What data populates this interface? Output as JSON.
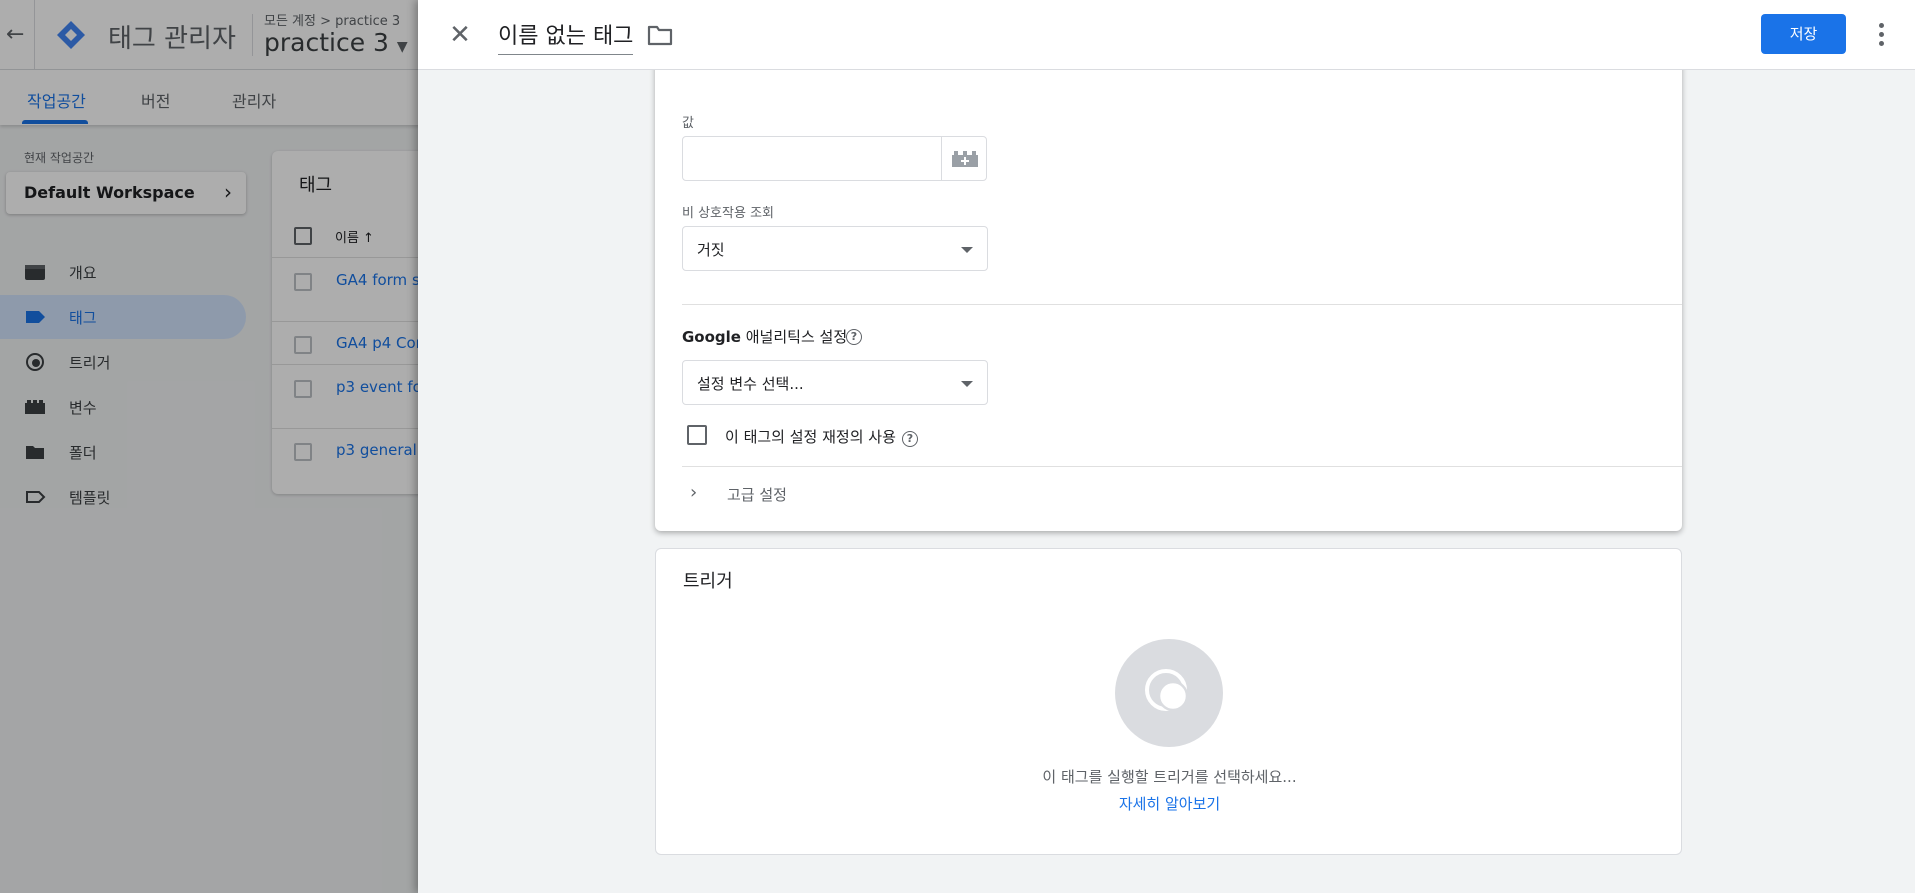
{
  "background_app": {
    "back_icon": "arrow-back-icon",
    "app_title": "태그 관리자",
    "breadcrumb_account": "모든 계정",
    "breadcrumb_sep": ">",
    "breadcrumb_container": "practice 3",
    "container_name": "practice 3",
    "tabs": [
      {
        "label": "작업공간",
        "active": true
      },
      {
        "label": "버전",
        "active": false
      },
      {
        "label": "관리자",
        "active": false
      }
    ],
    "workspace_label": "현재 작업공간",
    "workspace_name": "Default Workspace",
    "nav": [
      {
        "label": "개요",
        "icon": "overview-icon",
        "active": false
      },
      {
        "label": "태그",
        "icon": "tag-icon",
        "active": true
      },
      {
        "label": "트리거",
        "icon": "trigger-icon",
        "active": false
      },
      {
        "label": "변수",
        "icon": "variables-icon",
        "active": false
      },
      {
        "label": "폴더",
        "icon": "folder-icon",
        "active": false
      },
      {
        "label": "템플릿",
        "icon": "template-icon",
        "active": false
      }
    ],
    "tags_card": {
      "title": "태그",
      "column_name": "이름 ↑",
      "rows": [
        "GA4 form s",
        "GA4 p4 Cor",
        "p3 event fo",
        "p3 general c"
      ]
    }
  },
  "panel": {
    "tag_name": "이름 없는 태그",
    "save_label": "저장",
    "value_label": "값",
    "non_interaction_label": "비 상호작용 조회",
    "non_interaction_value": "거짓",
    "ga_settings_bold": "Google",
    "ga_settings_rest": " 애널리틱스 설정",
    "ga_settings_select": "설정 변수 선택...",
    "override_label": "이 태그의 설정 재정의 사용",
    "advanced_label": "고급 설정",
    "trigger_title": "트리거",
    "trigger_hint": "이 태그를 실행할 트리거를 선택하세요...",
    "trigger_learn_more": "자세히 알아보기"
  },
  "colors": {
    "accent": "#1a73e8",
    "nav_active_bg": "#d2e3fc"
  }
}
